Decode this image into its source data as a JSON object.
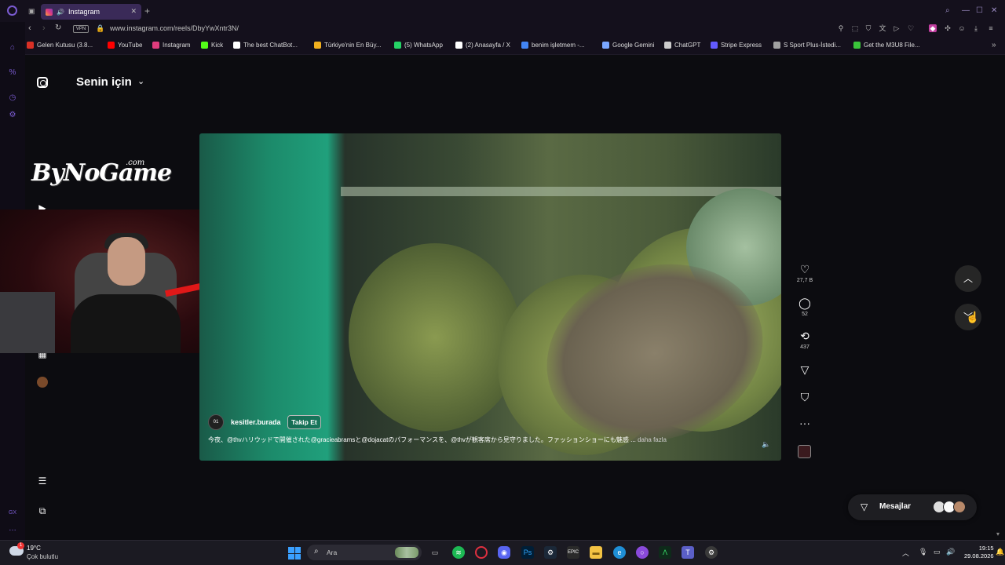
{
  "browser": {
    "tab_title": "Instagram",
    "url": "www.instagram.com/reels/DbyYwXntr3N/",
    "vpn_label": "VPN",
    "bookmarks": [
      {
        "label": "Gelen Kutusu (3.8...",
        "color": "#d93025"
      },
      {
        "label": "YouTube",
        "color": "#ff0000"
      },
      {
        "label": "Instagram",
        "color": "#e03c7d"
      },
      {
        "label": "Kick",
        "color": "#53fc18"
      },
      {
        "label": "The best ChatBot...",
        "color": "#ffffff"
      },
      {
        "label": "Türkiye'nin En Büy...",
        "color": "#f2b01e"
      },
      {
        "label": "(5) WhatsApp",
        "color": "#25d366"
      },
      {
        "label": "(2) Anasayfa / X",
        "color": "#ffffff"
      },
      {
        "label": "benim işletmem -...",
        "color": "#4285f4"
      },
      {
        "label": "Google Gemini",
        "color": "#7aa7ff"
      },
      {
        "label": "ChatGPT",
        "color": "#cccccc"
      },
      {
        "label": "Stripe Express",
        "color": "#635bff"
      },
      {
        "label": "S Sport Plus-İstedi...",
        "color": "#a0a0a0"
      },
      {
        "label": "Get the M3U8 File...",
        "color": "#3ac43a"
      }
    ]
  },
  "instagram": {
    "feed_title": "Senin için",
    "overlay_brand": "ByNoGame",
    "overlay_brand_suffix": ".com",
    "post": {
      "author": "kesitler.burada",
      "author_avatar_text": "01",
      "follow_label": "Takip Et",
      "caption": "今夜、@thvハリウッドで開催された@gracieabramsと@dojacatのパフォーマンスを、@thvが観客席から見守りました。ファッションショーにも魅惑 ...",
      "more_label": "daha fazla"
    },
    "actions": {
      "likes": "27,7 B",
      "comments": "52",
      "reposts": "437"
    },
    "messages_label": "Mesajlar"
  },
  "taskbar": {
    "temperature": "19°C",
    "weather": "Çok bulutlu",
    "weather_badge": "1",
    "search_placeholder": "Ara",
    "time": "19:15",
    "date": "29.08.2026"
  },
  "colors": {
    "accent": "#7a5bd0",
    "tab_active": "#3a2a58",
    "background": "#0c0c10"
  }
}
